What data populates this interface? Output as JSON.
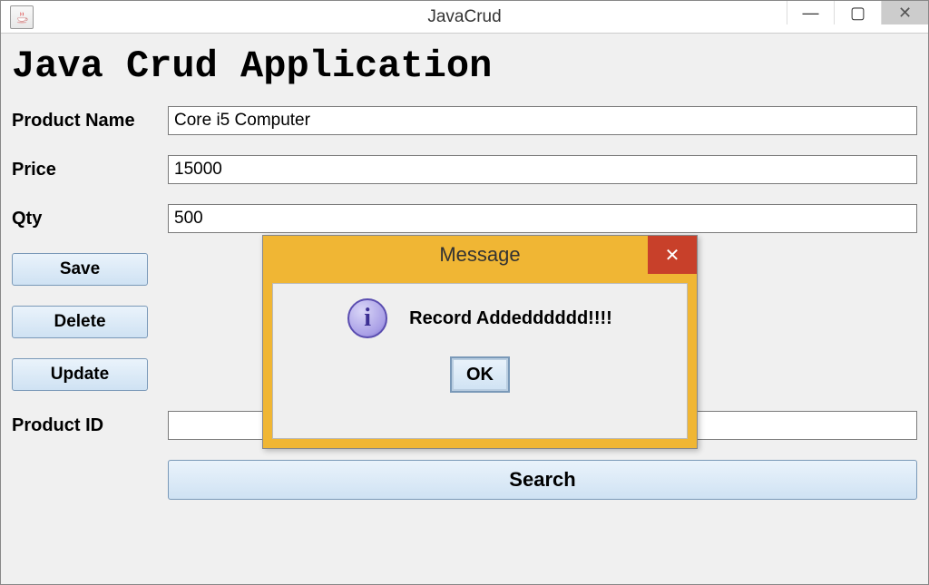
{
  "window": {
    "title": "JavaCrud",
    "min_label": "—",
    "max_label": "▢",
    "close_label": "✕"
  },
  "app": {
    "title": "Java Crud Application"
  },
  "form": {
    "product_name_label": "Product Name",
    "price_label": "Price",
    "qty_label": "Qty",
    "product_id_label": "Product ID",
    "product_name_value": "Core i5 Computer",
    "price_value": "15000",
    "qty_value": "500",
    "product_id_value": ""
  },
  "buttons": {
    "save": "Save",
    "delete": "Delete",
    "update": "Update",
    "search": "Search"
  },
  "dialog": {
    "title": "Message",
    "info_glyph": "i",
    "message": "Record Addedddddd!!!!",
    "ok": "OK",
    "close_glyph": "✕"
  }
}
